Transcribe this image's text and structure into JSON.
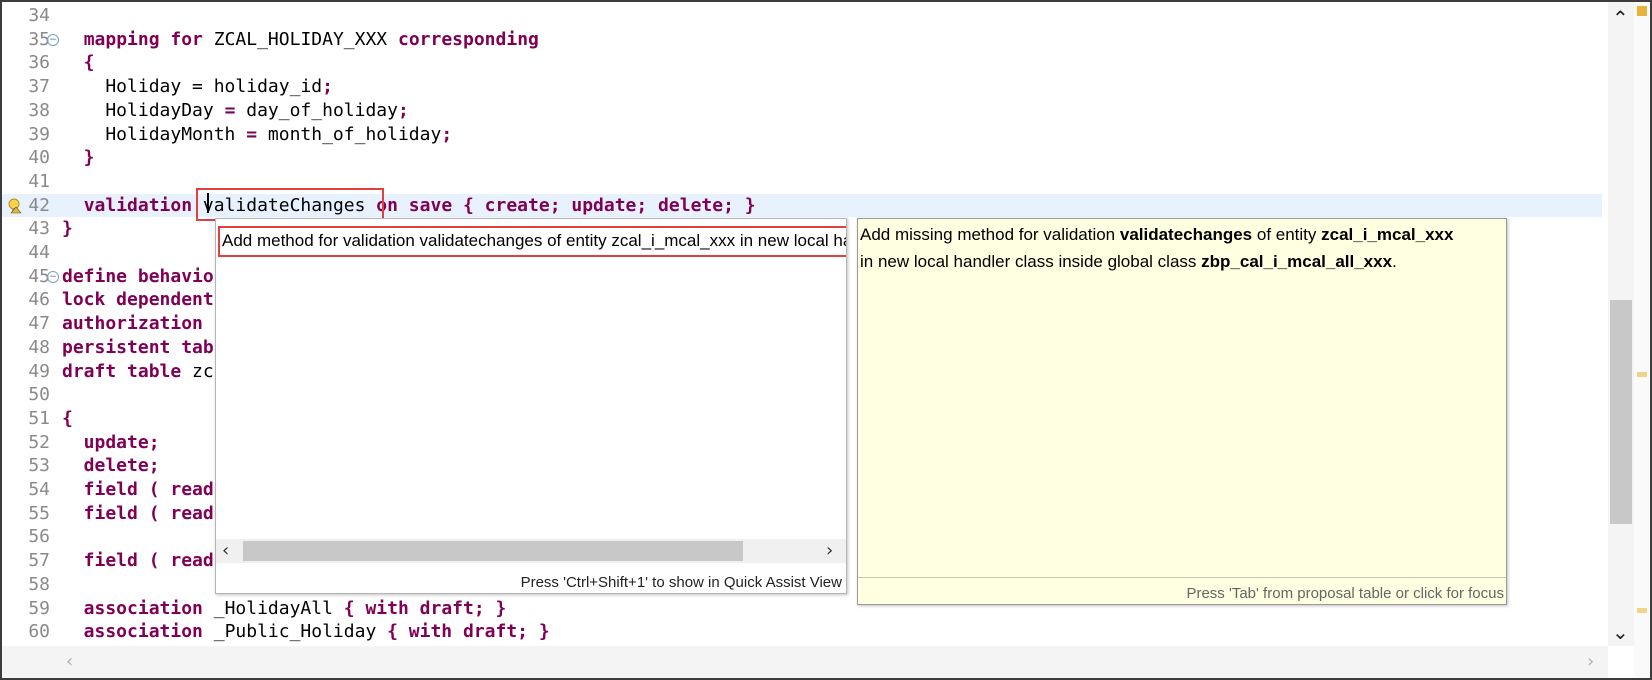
{
  "editor": {
    "lines": [
      {
        "num": "34",
        "parts": []
      },
      {
        "num": "35",
        "parts": [
          [
            "  ",
            ""
          ],
          [
            "mapping for",
            "kw"
          ],
          [
            " ZCAL_HOLIDAY_XXX ",
            ""
          ],
          [
            "corresponding",
            "kw"
          ]
        ]
      },
      {
        "num": "36",
        "parts": [
          [
            "  {",
            "kw"
          ]
        ]
      },
      {
        "num": "37",
        "parts": [
          [
            "    Holiday = holiday_id",
            ""
          ],
          [
            ";",
            "kw"
          ]
        ]
      },
      {
        "num": "38",
        "parts": [
          [
            "    HolidayDay ",
            ""
          ],
          [
            "=",
            "kw"
          ],
          [
            " day_of_holiday",
            ""
          ],
          [
            ";",
            "kw"
          ]
        ]
      },
      {
        "num": "39",
        "parts": [
          [
            "    HolidayMonth ",
            ""
          ],
          [
            "=",
            "kw"
          ],
          [
            " month_of_holiday",
            ""
          ],
          [
            ";",
            "kw"
          ]
        ]
      },
      {
        "num": "40",
        "parts": [
          [
            "  }",
            "kw"
          ]
        ]
      },
      {
        "num": "41",
        "parts": []
      },
      {
        "num": "42",
        "parts": [
          [
            "  ",
            ""
          ],
          [
            "validation",
            "kw"
          ],
          [
            " validateChanges ",
            ""
          ],
          [
            "on save { create; update; delete; }",
            "kw"
          ]
        ]
      },
      {
        "num": "43",
        "parts": [
          [
            "}",
            "kw"
          ]
        ]
      },
      {
        "num": "44",
        "parts": []
      },
      {
        "num": "45",
        "parts": [
          [
            "define behavio",
            "kw"
          ]
        ]
      },
      {
        "num": "46",
        "parts": [
          [
            "lock dependent",
            "kw"
          ]
        ]
      },
      {
        "num": "47",
        "parts": [
          [
            "authorization ",
            "kw"
          ]
        ]
      },
      {
        "num": "48",
        "parts": [
          [
            "persistent tab",
            "kw"
          ]
        ]
      },
      {
        "num": "49",
        "parts": [
          [
            "draft table",
            "kw"
          ],
          [
            " zc",
            ""
          ]
        ]
      },
      {
        "num": "50",
        "parts": []
      },
      {
        "num": "51",
        "parts": [
          [
            "{",
            "kw"
          ]
        ]
      },
      {
        "num": "52",
        "parts": [
          [
            "  update;",
            "kw"
          ]
        ]
      },
      {
        "num": "53",
        "parts": [
          [
            "  delete;",
            "kw"
          ]
        ]
      },
      {
        "num": "54",
        "parts": [
          [
            "  field ( read",
            "kw"
          ]
        ]
      },
      {
        "num": "55",
        "parts": [
          [
            "  field ( read",
            "kw"
          ]
        ]
      },
      {
        "num": "56",
        "parts": []
      },
      {
        "num": "57",
        "parts": [
          [
            "  field ( read",
            "kw"
          ]
        ]
      },
      {
        "num": "58",
        "parts": []
      },
      {
        "num": "59",
        "parts": [
          [
            "  association",
            "kw"
          ],
          [
            " _HolidayAll ",
            ""
          ],
          [
            "{ with draft; }",
            "kw"
          ]
        ]
      },
      {
        "num": "60",
        "parts": [
          [
            "  association",
            "kw"
          ],
          [
            " _Public_Holiday ",
            ""
          ],
          [
            "{ with draft; }",
            "kw"
          ]
        ]
      }
    ]
  },
  "proposals": {
    "item": "Add method for validation validatechanges of entity zcal_i_mcal_xxx in new local handler class inside global class zbp_cal_i_mcal_all_xxx",
    "status": "Press 'Ctrl+Shift+1' to show in Quick Assist View"
  },
  "info": {
    "line1_a": "Add missing method for validation ",
    "line1_b": "validatechanges",
    "line1_c": " of entity ",
    "line1_d": "zcal_i_mcal_xxx",
    "line2_a": " in new local handler class inside global class ",
    "line2_b": "zbp_cal_i_mcal_all_xxx",
    "line2_c": ".",
    "status": "Press 'Tab' from proposal table or click for focus"
  },
  "colors": {
    "keyword": "#7f0055",
    "current_line": "#e8f2fe",
    "tooltip_bg": "#ffffe1",
    "highlight_border": "#e04040"
  }
}
